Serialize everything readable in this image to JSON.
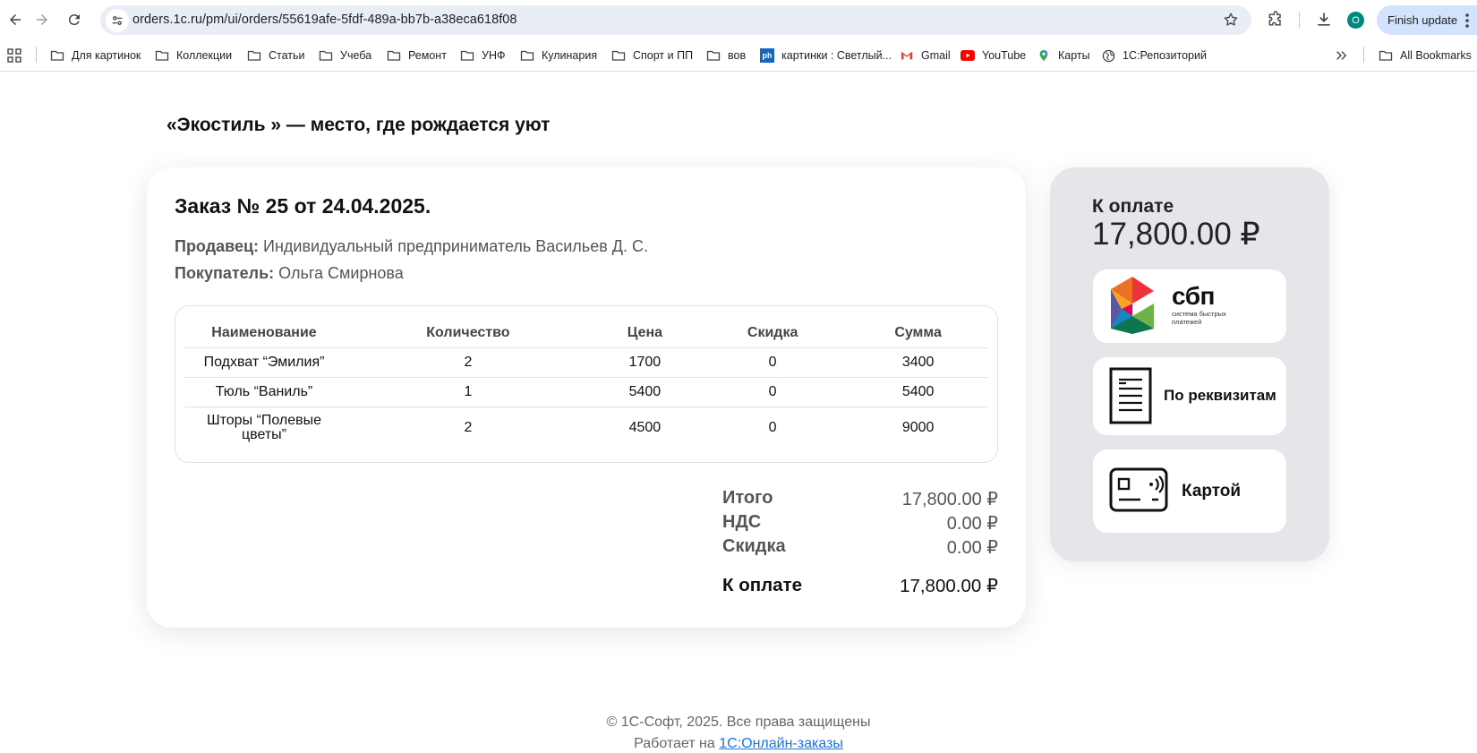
{
  "browser": {
    "url": "orders.1c.ru/pm/ui/orders/55619afe-5fdf-489a-bb7b-a38eca618f08",
    "avatar_letter": "O",
    "finish_update": "Finish update",
    "bookmarks": [
      {
        "label": "Для картинок",
        "icon": "folder-icon"
      },
      {
        "label": "Коллекции",
        "icon": "folder-icon"
      },
      {
        "label": "Статьи",
        "icon": "folder-icon"
      },
      {
        "label": "Учеба",
        "icon": "folder-icon"
      },
      {
        "label": "Ремонт",
        "icon": "folder-icon"
      },
      {
        "label": "УНФ",
        "icon": "folder-icon"
      },
      {
        "label": "Кулинария",
        "icon": "folder-icon"
      },
      {
        "label": "Спорт и ПП",
        "icon": "folder-icon"
      },
      {
        "label": "вов",
        "icon": "folder-icon"
      },
      {
        "label": "картинки : Светлый...",
        "icon": "ph-icon"
      },
      {
        "label": "Gmail",
        "icon": "gmail-icon"
      },
      {
        "label": "YouTube",
        "icon": "youtube-icon"
      },
      {
        "label": "Карты",
        "icon": "maps-icon"
      },
      {
        "label": "1С:Репозиторий",
        "icon": "globe-icon"
      }
    ],
    "all_bookmarks": "All Bookmarks",
    "ph_badge": "ph"
  },
  "page": {
    "heading": "«Экостиль » — место, где рождается уют"
  },
  "order": {
    "title": "Заказ № 25 от 24.04.2025.",
    "seller_label": "Продавец:",
    "seller": "Индивидуальный предприниматель Васильев Д. С.",
    "buyer_label": "Покупатель:",
    "buyer": "Ольга Смирнова",
    "columns": [
      "Наименование",
      "Количество",
      "Цена",
      "Скидка",
      "Сумма"
    ],
    "rows": [
      [
        "Подхват “Эмилия”",
        "2",
        "1700",
        "0",
        "3400"
      ],
      [
        "Тюль “Ваниль”",
        "1",
        "5400",
        "0",
        "5400"
      ],
      [
        "Шторы “Полевые цветы”",
        "2",
        "4500",
        "0",
        "9000"
      ]
    ],
    "totals": [
      {
        "label": "Итого",
        "value": "17,800.00 ₽"
      },
      {
        "label": "НДС",
        "value": "0.00 ₽"
      },
      {
        "label": "Скидка",
        "value": "0.00 ₽"
      }
    ],
    "final": {
      "label": "К оплате",
      "value": "17,800.00 ₽"
    }
  },
  "payment": {
    "label": "К оплате",
    "amount": "17,800.00 ₽",
    "sbp_title": "сбп",
    "sbp_subtitle_1": "система быстрых",
    "sbp_subtitle_2": "платежей",
    "details_label": "По реквизитам",
    "card_label": "Картой"
  },
  "footer": {
    "copyright": "© 1С-Софт, 2025. Все права защищены",
    "powered_prefix": "Работает на",
    "powered_link": "1С:Онлайн-заказы"
  },
  "colors": {
    "accent": "#1a73e8",
    "avatar": "#00897b",
    "side_panel": "#e5e6e9"
  }
}
